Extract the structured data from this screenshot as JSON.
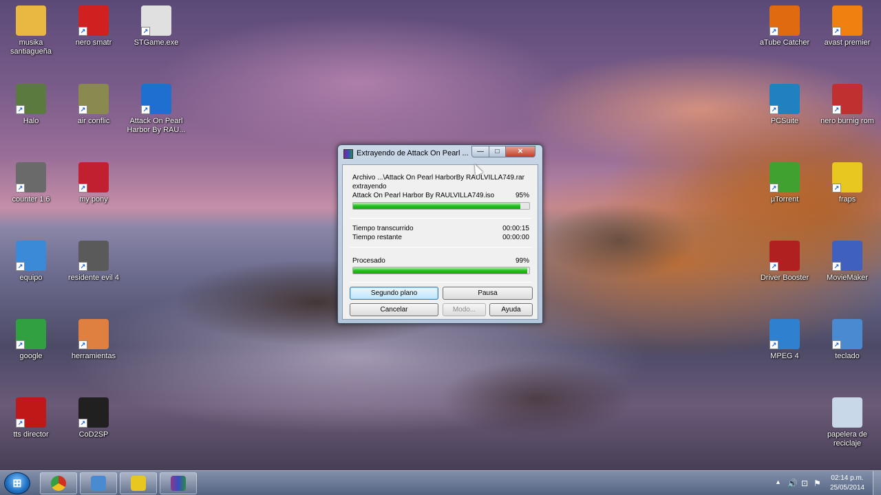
{
  "desktop": {
    "icons": [
      {
        "label": "musika santiagueña",
        "icon": "folder-icon",
        "color": "#e8b840"
      },
      {
        "label": "nero smatr",
        "icon": "nero-icon",
        "color": "#d02020"
      },
      {
        "label": "STGame.exe",
        "icon": "game-icon",
        "color": "#e0e0e0"
      },
      {
        "label": "Halo",
        "icon": "halo-icon",
        "color": "#5a7a40"
      },
      {
        "label": "air conflic",
        "icon": "aircraft-icon",
        "color": "#8a8a50"
      },
      {
        "label": "Attack On Pearl Harbor By RAU...",
        "icon": "lightning-icon",
        "color": "#1e6fd0"
      },
      {
        "label": "counter 1.6",
        "icon": "counter-strike-icon",
        "color": "#6a6a6a"
      },
      {
        "label": "my pony",
        "icon": "pony-icon",
        "color": "#c02030"
      },
      {
        "label": "equipo",
        "icon": "computer-icon",
        "color": "#3a8ad8"
      },
      {
        "label": "residente evil 4",
        "icon": "resident-evil-icon",
        "color": "#5a5a5a"
      },
      {
        "label": "google",
        "icon": "chrome-icon",
        "color": "#30a040"
      },
      {
        "label": "herramientas",
        "icon": "tools-icon",
        "color": "#e08040"
      },
      {
        "label": "tts director",
        "icon": "tts-icon",
        "color": "#c01818"
      },
      {
        "label": "CoD2SP",
        "icon": "cod2-icon",
        "color": "#202020"
      },
      {
        "label": "aTube Catcher",
        "icon": "atube-icon",
        "color": "#e06a10"
      },
      {
        "label": "avast premier",
        "icon": "avast-icon",
        "color": "#f08010"
      },
      {
        "label": "PCSuite",
        "icon": "pcsuite-icon",
        "color": "#2080c0"
      },
      {
        "label": "nero burnig rom",
        "icon": "nero-burning-icon",
        "color": "#c03030"
      },
      {
        "label": "µTorrent",
        "icon": "utorrent-icon",
        "color": "#40a030"
      },
      {
        "label": "fraps",
        "icon": "fraps-icon",
        "color": "#e8c820"
      },
      {
        "label": "Driver Booster",
        "icon": "driver-booster-icon",
        "color": "#b02020"
      },
      {
        "label": "MovieMaker",
        "icon": "moviemaker-icon",
        "color": "#4060c0"
      },
      {
        "label": "MPEG 4",
        "icon": "mpeg4-icon",
        "color": "#3080d0"
      },
      {
        "label": "teclado",
        "icon": "keyboard-icon",
        "color": "#4a8ad0"
      },
      {
        "label": "papelera de reciclaje",
        "icon": "recycle-bin-icon",
        "color": "#c8d8e8"
      }
    ]
  },
  "dialog": {
    "title": "Extrayendo de Attack On Pearl ...",
    "minimize": "—",
    "maximize": "□",
    "close": "✕",
    "archive_line": "Archivo ...\\Attack On Pearl HarborBy RAULVILLA749.rar",
    "status": "extrayendo",
    "file_name": "Attack On Pearl Harbor By RAULVILLA749.iso",
    "file_percent": "95%",
    "file_progress": 0.95,
    "elapsed_label": "Tiempo transcurrido",
    "elapsed_value": "00:00:15",
    "remaining_label": "Tiempo restante",
    "remaining_value": "00:00:00",
    "processed_label": "Procesado",
    "processed_percent": "99%",
    "processed_progress": 0.99,
    "buttons": {
      "background": "Segundo plano",
      "pause": "Pausa",
      "cancel": "Cancelar",
      "mode": "Modo...",
      "help": "Ayuda"
    }
  },
  "taskbar": {
    "start_glyph": "⊞",
    "apps": [
      {
        "name": "chrome",
        "color": "#e0a020"
      },
      {
        "name": "keyboard",
        "color": "#4a8ad0"
      },
      {
        "name": "fraps",
        "color": "#e8c820"
      },
      {
        "name": "winrar",
        "color": "#8a3a8a"
      }
    ],
    "tray": {
      "time": "02:14 p.m.",
      "date": "25/05/2014",
      "up_arrow": "▲",
      "volume": "🔊",
      "network": "⊡",
      "flag": "⚑"
    }
  }
}
